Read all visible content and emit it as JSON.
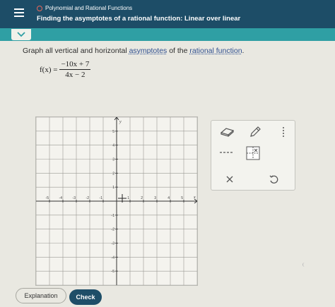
{
  "header": {
    "topic": "Polynomial and Rational Functions",
    "title": "Finding the asymptotes of a rational function: Linear over linear"
  },
  "question": {
    "prefix": "Graph all vertical and horizontal ",
    "link1": "asymptotes",
    "middle": " of the ",
    "link2": "rational function",
    "suffix": "."
  },
  "formula": {
    "lhs": "f(x) =",
    "numerator": "−10x + 7",
    "denominator": "4x − 2"
  },
  "graph": {
    "x_axis_label": "x",
    "y_axis_label": "y",
    "x_ticks": [
      -5,
      -4,
      -3,
      -2,
      -1,
      1,
      2,
      3,
      4,
      5
    ],
    "y_ticks": [
      -5,
      -4,
      -3,
      -2,
      -1,
      1,
      2,
      3,
      4,
      5
    ],
    "xlim": [
      -6,
      6
    ],
    "ylim": [
      -6,
      6
    ]
  },
  "tools": {
    "eraser_icon": "eraser-icon",
    "pencil_icon": "pencil-icon",
    "more_icon": "vertical-dots-icon",
    "dashed_line_icon": "dashed-line-icon",
    "asymptote_icon": "asymptote-grid-icon",
    "clear_icon": "x-icon",
    "undo_icon": "undo-icon"
  },
  "buttons": {
    "explanation": "Explanation",
    "check": "Check"
  },
  "colors": {
    "header_bg": "#1d4d67",
    "teal_bar": "#2f9fa4",
    "check_bg": "#1e4e68",
    "topic_dot": "#e7665a"
  }
}
